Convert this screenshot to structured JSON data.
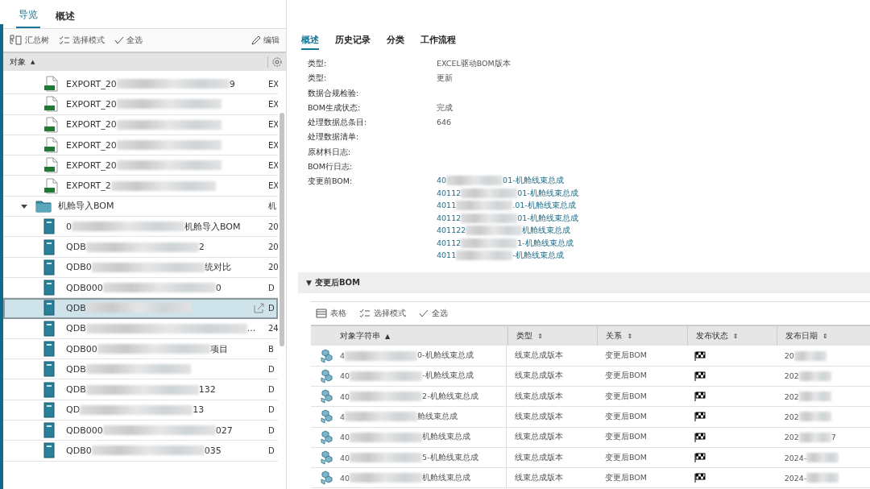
{
  "nav_tabs": [
    {
      "label": "导览",
      "selected": true
    },
    {
      "label": "概述",
      "selected": false
    }
  ],
  "left_toolbar": {
    "tree_button": "汇总树",
    "select_mode": "选择模式",
    "select_all": "全选",
    "edit": "编辑"
  },
  "tree_header": {
    "label": "对象",
    "sort": "▲"
  },
  "tree": [
    {
      "kind": "excel",
      "start": "EXPORT_20",
      "end": "9",
      "column_2": "EX",
      "selected": false
    },
    {
      "kind": "excel",
      "start": "EXPORT_20",
      "column_2": "EX",
      "selected": false
    },
    {
      "kind": "excel",
      "start": "EXPORT_20",
      "column_2": "EX",
      "selected": false
    },
    {
      "kind": "excel",
      "start": "EXPORT_20",
      "column_2": "EX",
      "selected": false
    },
    {
      "kind": "excel",
      "start": "EXPORT_20",
      "column_2": "EX",
      "selected": false
    },
    {
      "kind": "excel",
      "start": "EXPORT_2",
      "column_2": "EX",
      "selected": false
    },
    {
      "kind": "folder",
      "start": "机舱导入BOM",
      "column_2": "机",
      "expanded": true,
      "selected": false,
      "children": [
        {
          "kind": "book",
          "start": "0",
          "end": "机舱导入BOM",
          "column_2": "20",
          "selected": false
        },
        {
          "kind": "book",
          "start": "QDB",
          "end": "2",
          "column_2": "20",
          "selected": false
        },
        {
          "kind": "book",
          "start": "QDB0",
          "end": "统对比",
          "column_2": "20",
          "selected": false
        },
        {
          "kind": "book",
          "start": "QDB000",
          "end": "0",
          "column_2": "D",
          "selected": false
        },
        {
          "kind": "book",
          "start": "QDB",
          "column_2": "D",
          "selected": true
        },
        {
          "kind": "book",
          "start": "QDB",
          "end": "...",
          "column_2": "24",
          "selected": false
        },
        {
          "kind": "book",
          "start": "QDB00",
          "end": "项目",
          "column_2": "B",
          "selected": false
        },
        {
          "kind": "book",
          "start": "QDB",
          "column_2": "D",
          "selected": false
        },
        {
          "kind": "book",
          "start": "QDB",
          "end": "132",
          "column_2": "D",
          "selected": false
        },
        {
          "kind": "book",
          "start": "QD",
          "end": "13",
          "column_2": "D",
          "selected": false
        },
        {
          "kind": "book",
          "start": "QDB000",
          "end": "027",
          "column_2": "D",
          "selected": false
        },
        {
          "kind": "book",
          "start": "QDB0",
          "end": "035",
          "column_2": "D",
          "selected": false
        }
      ]
    }
  ],
  "detail_tabs": [
    {
      "label": "概述",
      "selected": true
    },
    {
      "label": "历史记录",
      "selected": false
    },
    {
      "label": "分类",
      "selected": false
    },
    {
      "label": "工作流程",
      "selected": false
    }
  ],
  "properties": [
    {
      "label": "类型:",
      "value": "EXCEL驱动BOM版本"
    },
    {
      "label": "类型:",
      "value": "更新"
    },
    {
      "label": "数据合规检验:"
    },
    {
      "label": "BOM生成状态:",
      "value": "完成"
    },
    {
      "label": "处理数据总条目:",
      "value": "646"
    },
    {
      "label": "处理数据清单:"
    },
    {
      "label": "原材料日志:"
    },
    {
      "label": "BOM行日志:"
    },
    {
      "label": "变更前BOM:",
      "links": [
        {
          "start": "40",
          "end": "01-机舱线束总成"
        },
        {
          "start": "40112",
          "end": "01-机舱线束总成"
        },
        {
          "start": "4011",
          "end": ".01-机舱线束总成"
        },
        {
          "start": "40112",
          "end": "01-机舱线束总成"
        },
        {
          "start": "401122",
          "end": "机舱线束总成"
        },
        {
          "start": "40112",
          "end": "1-机舱线束总成"
        },
        {
          "start": "4011",
          "end": "-机舱线束总成"
        }
      ]
    }
  ],
  "after_bom": {
    "toggle": "▼",
    "title": "变更后BOM",
    "toolbar": {
      "table": "表格",
      "select_mode": "选择模式",
      "select_all": "全选"
    },
    "columns": [
      {
        "label": "对象字符串",
        "sort": "▲"
      },
      {
        "label": "类型",
        "sort": "⇕"
      },
      {
        "label": "关系",
        "sort": "⇕"
      },
      {
        "label": "发布状态",
        "sort": "⇕"
      },
      {
        "label": "发布日期",
        "sort": "⇕"
      }
    ],
    "rows": [
      {
        "start": "4",
        "end": "0-机舱线束总成",
        "type": "线束总成版本",
        "relation": "变更后BOM",
        "date_start": "20"
      },
      {
        "start": "40",
        "end": "-机舱线束总成",
        "type": "线束总成版本",
        "relation": "变更后BOM",
        "date_start": "202"
      },
      {
        "start": "40",
        "end": "2-机舱线束总成",
        "type": "线束总成版本",
        "relation": "变更后BOM",
        "date_start": "202"
      },
      {
        "start": "4",
        "end": "舱线束总成",
        "type": "线束总成版本",
        "relation": "变更后BOM",
        "date_start": "202"
      },
      {
        "start": "40",
        "end": "机舱线束总成",
        "type": "线束总成版本",
        "relation": "变更后BOM",
        "date_start": "202",
        "date_end": "7"
      },
      {
        "start": "40",
        "end": "5-机舱线束总成",
        "type": "线束总成版本",
        "relation": "变更后BOM",
        "date_start": "2024-"
      },
      {
        "start": "40",
        "end": "机舱线束总成",
        "type": "线束总成版本",
        "relation": "变更后BOM",
        "date_start": "2024-"
      }
    ]
  }
}
